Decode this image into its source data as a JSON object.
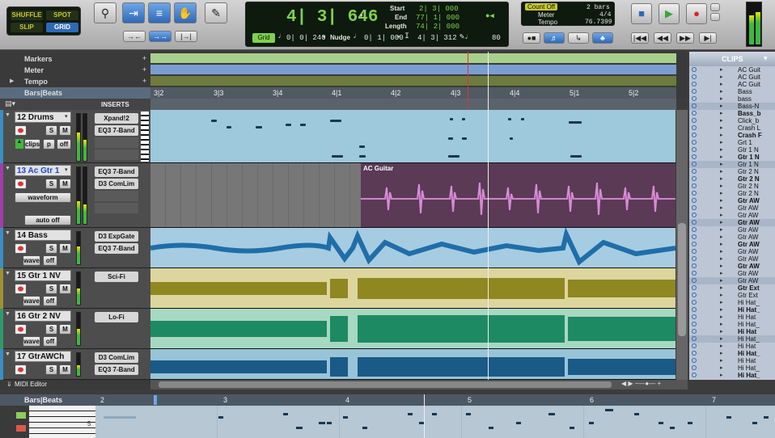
{
  "toolbar": {
    "modes": {
      "shuffle": "SHUFFLE",
      "spot": "SPOT",
      "slip": "SLIP",
      "grid": "GRID"
    },
    "counter": {
      "main": "4| 3| 646",
      "start_label": "Start",
      "start": "2| 3| 000",
      "end_label": "End",
      "end": "77| 1| 000",
      "length_label": "Length",
      "length": "74| 2| 000",
      "cursor": "4| 3| 312"
    },
    "grid": {
      "label": "Grid",
      "value": "0| 0| 240",
      "nudge_label": "Nudge",
      "nudge_value": "0| 1| 000",
      "tempo_value": "80"
    },
    "meter": {
      "count_off": "Count Off",
      "bars": "2 bars",
      "meter_label": "Meter",
      "meter_value": "4/4",
      "tempo_label": "Tempo",
      "tempo_value": "76.7399"
    }
  },
  "rulers": {
    "markers": "Markers",
    "meter": "Meter",
    "tempo": "Tempo",
    "barsbeats": "Bars|Beats",
    "inserts": "INSERTS",
    "ticks": [
      "3|2",
      "3|3",
      "3|4",
      "4|1",
      "4|2",
      "4|3",
      "4|4",
      "5|1",
      "5|2"
    ]
  },
  "tracks": [
    {
      "name": "12  Drums",
      "inserts": [
        "Xpand!2",
        "EQ3 7-Band"
      ],
      "view": "clips",
      "opt1": "p",
      "opt2": "off"
    },
    {
      "name": "13  Ac Gtr 1",
      "inserts": [
        "EQ3 7-Band",
        "D3 ComLim"
      ],
      "view": "waveform",
      "auto": "auto off",
      "clip": "AC Guitar"
    },
    {
      "name": "14   Bass",
      "inserts": [
        "D3 ExpGate",
        "EQ3 7-Band"
      ],
      "view": "wave",
      "opt2": "off"
    },
    {
      "name": "15  Gtr 1 NV",
      "inserts": [
        "Sci-Fi"
      ],
      "view": "wave",
      "opt2": "off"
    },
    {
      "name": "16  Gtr 2 NV",
      "inserts": [
        "Lo-Fi"
      ],
      "view": "wave",
      "opt2": "off"
    },
    {
      "name": "17  GtrAWCh",
      "inserts": [
        "D3 ComLim",
        "EQ3 7-Band"
      ],
      "view": "wave",
      "opt2": "off"
    }
  ],
  "clips": {
    "title": "CLIPS",
    "items": [
      "AC Guit",
      "AC Guit",
      "AC Guit",
      "Bass",
      "bass",
      "Bass-N",
      "Bass_b",
      "Click_b",
      "Crash L",
      "Crash F",
      "Grt 1",
      "Gtr 1 N",
      "Gtr 1 N",
      "Gtr 1 N",
      "Gtr 2 N",
      "Gtr 2 N",
      "Gtr 2 N",
      "Gtr 2 N",
      "Gtr AW",
      "Gtr AW",
      "Gtr AW",
      "Gtr AW",
      "Gtr AW",
      "Gtr AW",
      "Gtr AW",
      "Gtr AW",
      "Gtr AW",
      "Gtr AW",
      "Gtr AW",
      "Gtr AW",
      "Gtr Ext",
      "Gtr Ext",
      "Hi Hat_",
      "Hi Hat_",
      "Hi Hat",
      "Hi Hat_",
      "Hi Hat",
      "Hi Hat_",
      "Hi Hat",
      "Hi Hat_",
      "Hi Hat",
      "Hi Hat_",
      "Hi Hat_"
    ]
  },
  "midi_editor": {
    "label": "MIDI Editor",
    "ruler": "Bars|Beats",
    "ticks": [
      "2",
      "3",
      "4",
      "5",
      "6",
      "7"
    ],
    "key_label": "5"
  },
  "colors": {
    "accent": "#2e69b8",
    "lcd": "#7fd14d",
    "drums_lane": "#9ec8dc",
    "guitar_clip": "#5a3a55",
    "bass_lane": "#a6cce2",
    "gtr1_lane": "#dcd59e",
    "gtr2_lane": "#a6d8c2",
    "gtraw_lane": "#98c4d8"
  }
}
